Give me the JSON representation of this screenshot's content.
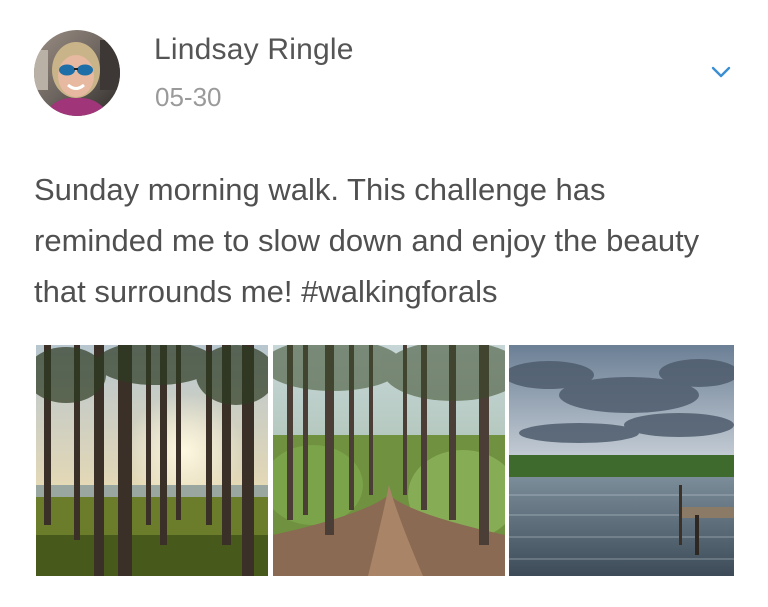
{
  "post": {
    "author": "Lindsay Ringle",
    "date": "05-30",
    "text": "Sunday morning walk. This challenge has reminded me to slow down and enjoy the beauty that surrounds me! #walkingforals",
    "menu_icon": "chevron-down-icon",
    "accent_color": "#3a8fd4"
  },
  "photos": [
    {
      "name": "sunrise-forest-photo"
    },
    {
      "name": "forest-trail-photo"
    },
    {
      "name": "lake-dock-photo"
    }
  ]
}
